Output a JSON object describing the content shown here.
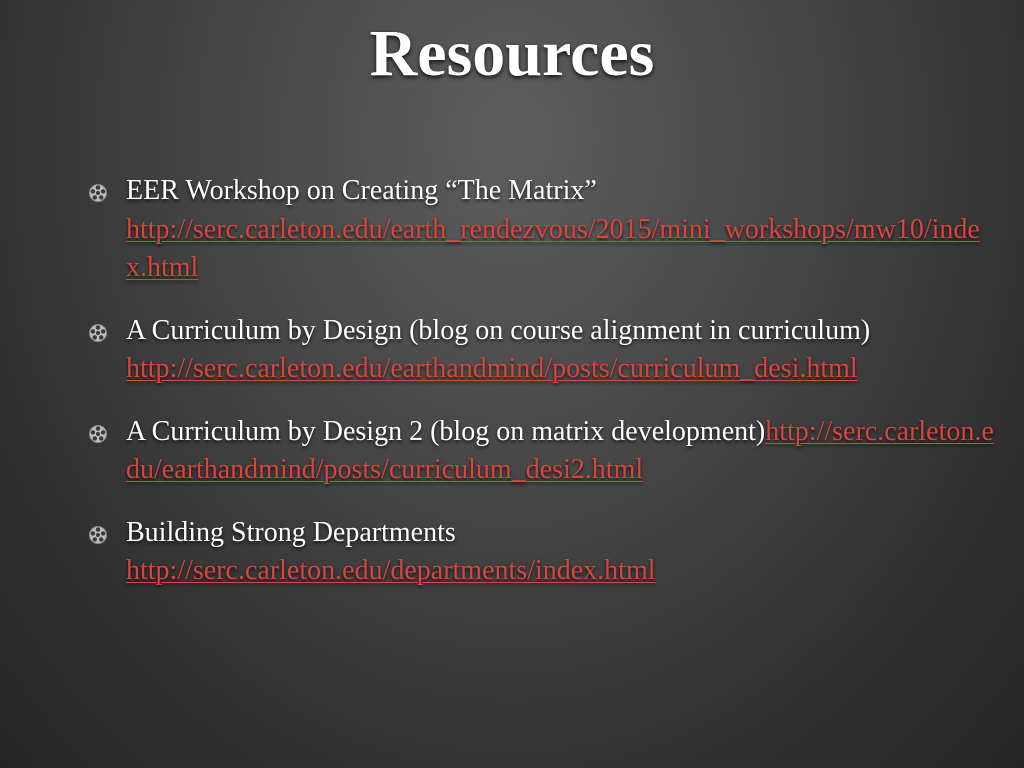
{
  "slide": {
    "title": "Resources",
    "accent_link_color": "#d7453f",
    "bullet_icon": "film-reel-icon",
    "bullets": [
      {
        "text": "EER Workshop on Creating “The Matrix” ",
        "link": "http://serc.carleton.edu/earth_rendezvous/2015/mini_workshops/mw10/index.html"
      },
      {
        "text": "A Curriculum by Design (blog on course alignment in curriculum) ",
        "link": "http://serc.carleton.edu/earthandmind/posts/curriculum_desi.html"
      },
      {
        "text": "A Curriculum by Design 2  (blog on matrix development)",
        "link": "http://serc.carleton.edu/earthandmind/posts/curriculum_desi2.html"
      },
      {
        "text": "Building Strong Departments ",
        "link": "http://serc.carleton.edu/departments/index.html"
      }
    ]
  }
}
